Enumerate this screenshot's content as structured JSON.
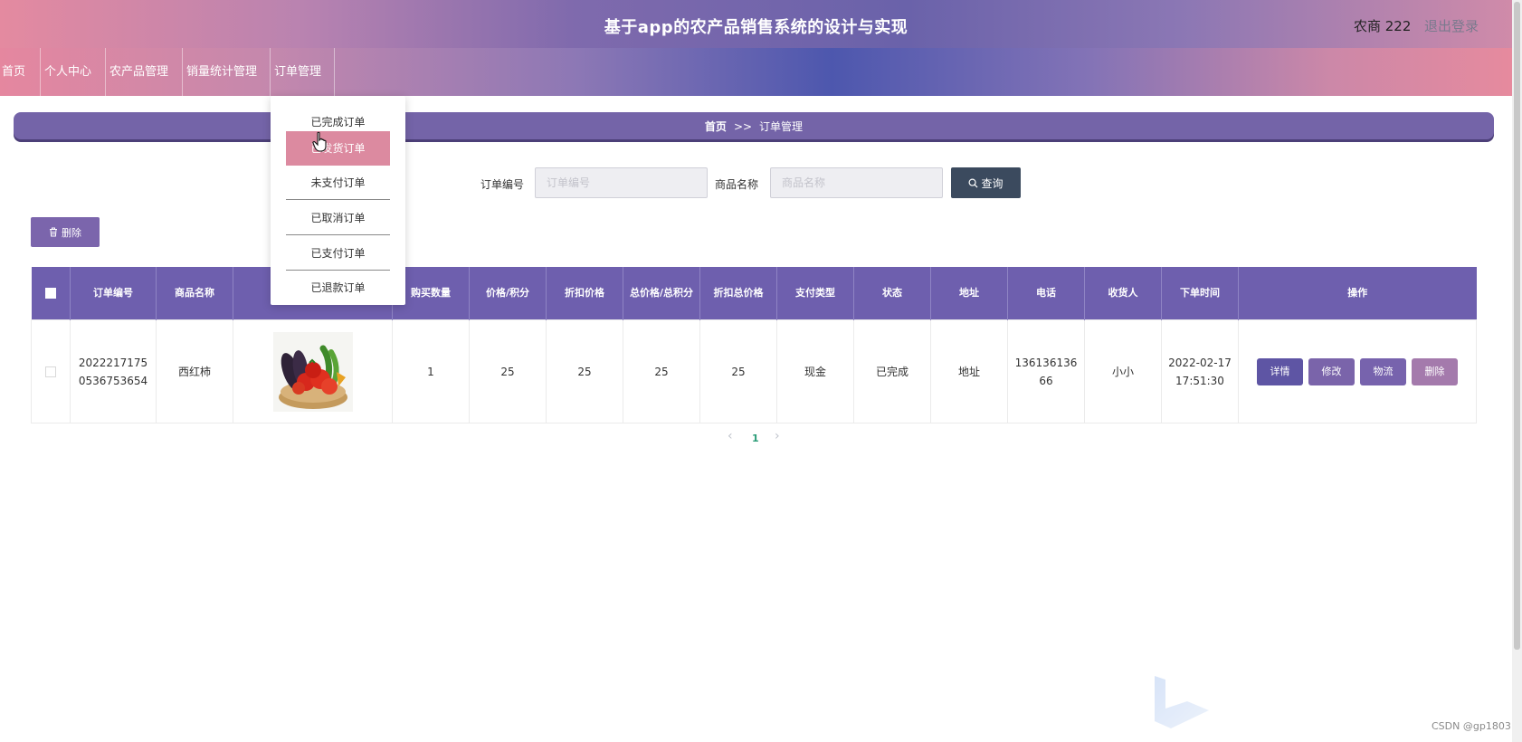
{
  "header": {
    "title": "基于app的农产品销售系统的设计与实现",
    "user": "农商 222",
    "logout": "退出登录"
  },
  "nav": {
    "items": [
      {
        "label": "首页",
        "has_dropdown": false
      },
      {
        "label": "个人中心",
        "has_dropdown": true
      },
      {
        "label": "农产品管理",
        "has_dropdown": true
      },
      {
        "label": "销量统计管理",
        "has_dropdown": true
      },
      {
        "label": "订单管理",
        "has_dropdown": true
      }
    ]
  },
  "dropdown": {
    "items": [
      {
        "label": "已完成订单",
        "active": false
      },
      {
        "label": "已发货订单",
        "active": true
      },
      {
        "label": "未支付订单",
        "active": false
      },
      {
        "label": "已取消订单",
        "active": false
      },
      {
        "label": "已支付订单",
        "active": false
      },
      {
        "label": "已退款订单",
        "active": false
      }
    ]
  },
  "breadcrumb": {
    "home": "首页",
    "separator": ">>",
    "current": "订单管理"
  },
  "search": {
    "order_no_label": "订单编号",
    "order_no_placeholder": "订单编号",
    "order_no_value": "",
    "product_name_label": "商品名称",
    "product_name_placeholder": "商品名称",
    "product_name_value": "",
    "search_button": "查询"
  },
  "toolbar": {
    "delete_button": "删除"
  },
  "table": {
    "columns": [
      "订单编号",
      "商品名称",
      "",
      "购买数量",
      "价格/积分",
      "折扣价格",
      "总价格/总积分",
      "折扣总价格",
      "支付类型",
      "状态",
      "地址",
      "电话",
      "收货人",
      "下单时间",
      "操作"
    ],
    "rows": [
      {
        "order_no": "20222171750536753654",
        "product_name": "西红柿",
        "image": "vegetable-basket",
        "quantity": "1",
        "price": "25",
        "discount_price": "25",
        "total_price": "25",
        "discount_total": "25",
        "pay_type": "现金",
        "status": "已完成",
        "address": "地址",
        "phone": "13613613666",
        "receiver": "小小",
        "order_time": "2022-02-17 17:51:30",
        "actions": {
          "detail": "详情",
          "edit": "修改",
          "logistics": "物流",
          "delete": "删除"
        }
      }
    ]
  },
  "pagination": {
    "prev": "‹",
    "current": "1",
    "next": "›"
  },
  "watermark": {
    "text": "CSDN @gp1803"
  },
  "colors": {
    "accent_purple": "#6e5fae",
    "dropdown_active": "#dc8aa0",
    "search_button": "#3b4a5e",
    "detail_button": "#5e55a4",
    "edit_button": "#7a64aa",
    "logistics_button": "#7763ad",
    "delete_row_button": "#a47aac",
    "page_active": "#2a9c77"
  }
}
